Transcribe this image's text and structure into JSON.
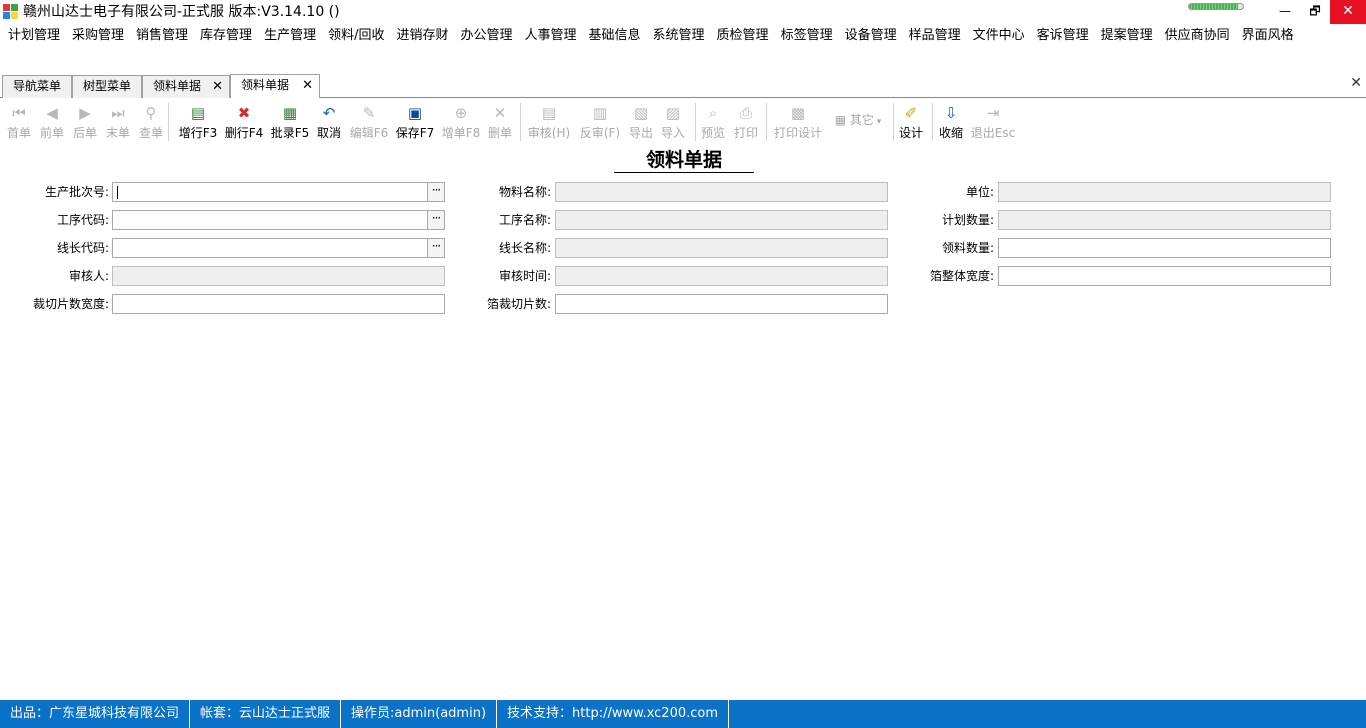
{
  "window": {
    "title": "赣州山达士电子有限公司-正式服 版本:V3.14.10 ()",
    "progress_value": 0.9,
    "minimize": "—",
    "maximize": "🗗",
    "close": "✕"
  },
  "menu": [
    "计划管理",
    "采购管理",
    "销售管理",
    "库存管理",
    "生产管理",
    "领料/回收",
    "进销存财",
    "办公管理",
    "人事管理",
    "基础信息",
    "系统管理",
    "质检管理",
    "标签管理",
    "设备管理",
    "样品管理",
    "文件中心",
    "客诉管理",
    "提案管理",
    "供应商协同",
    "界面风格"
  ],
  "tabs": [
    {
      "label": "导航菜单",
      "closable": false,
      "active": false
    },
    {
      "label": "树型菜单",
      "closable": false,
      "active": false
    },
    {
      "label": "领料单据",
      "closable": true,
      "active": false
    },
    {
      "label": "领料单据",
      "closable": true,
      "active": true
    }
  ],
  "tab_close_glyph": "✕",
  "toolbar": [
    {
      "label": "首单",
      "icon": "first-record-icon",
      "glyph": "⏮",
      "enabled": false
    },
    {
      "label": "前单",
      "icon": "previous-record-icon",
      "glyph": "◀",
      "enabled": false
    },
    {
      "label": "后单",
      "icon": "next-record-icon",
      "glyph": "▶",
      "enabled": false
    },
    {
      "label": "末单",
      "icon": "last-record-icon",
      "glyph": "⏭",
      "enabled": false
    },
    {
      "label": "查单",
      "icon": "binoculars-icon",
      "glyph": "⚲",
      "enabled": false
    },
    {
      "label": "增行F3",
      "icon": "add-row-icon",
      "glyph": "▤",
      "enabled": true,
      "color": "#2e7d32"
    },
    {
      "label": "删行F4",
      "icon": "delete-row-icon",
      "glyph": "✖",
      "enabled": true,
      "color": "#d32f2f"
    },
    {
      "label": "批录F5",
      "icon": "batch-entry-icon",
      "glyph": "▦",
      "enabled": true,
      "color": "#2e7d32"
    },
    {
      "label": "取消",
      "icon": "undo-icon",
      "glyph": "↶",
      "enabled": true,
      "color": "#1565c0"
    },
    {
      "label": "编辑F6",
      "icon": "edit-icon",
      "glyph": "✎",
      "enabled": false
    },
    {
      "label": "保存F7",
      "icon": "save-icon",
      "glyph": "▣",
      "enabled": true,
      "color": "#0d47a1"
    },
    {
      "label": "增单F8",
      "icon": "add-document-icon",
      "glyph": "⊕",
      "enabled": false
    },
    {
      "label": "删单",
      "icon": "delete-document-icon",
      "glyph": "✕",
      "enabled": false
    },
    {
      "label": "审核(H)",
      "icon": "approve-icon",
      "glyph": "▤",
      "enabled": false
    },
    {
      "label": "反审(F)",
      "icon": "unapprove-icon",
      "glyph": "▥",
      "enabled": false
    },
    {
      "label": "导出",
      "icon": "export-icon",
      "glyph": "▧",
      "enabled": false
    },
    {
      "label": "导入",
      "icon": "import-icon",
      "glyph": "▨",
      "enabled": false
    },
    {
      "label": "预览",
      "icon": "preview-icon",
      "glyph": "⌕",
      "enabled": false
    },
    {
      "label": "打印",
      "icon": "printer-icon",
      "glyph": "⎙",
      "enabled": false
    },
    {
      "label": "打印设计",
      "icon": "print-design-icon",
      "glyph": "▩",
      "enabled": false
    },
    {
      "label": "其它",
      "icon": "more-icon",
      "glyph": "▦",
      "enabled": false,
      "dropdown": true
    },
    {
      "label": "设计",
      "icon": "design-icon",
      "glyph": "✐",
      "enabled": true,
      "color": "#e0a000"
    },
    {
      "label": "收缩",
      "icon": "collapse-icon",
      "glyph": "⇩",
      "enabled": true,
      "color": "#1565c0"
    },
    {
      "label": "退出Esc",
      "icon": "exit-icon",
      "glyph": "⇥",
      "enabled": false
    }
  ],
  "form": {
    "title": "领料单据",
    "fields": [
      {
        "key": "batch_no",
        "label": "生产批次号:",
        "value": "",
        "readonly": false,
        "lookup": true,
        "focused": true
      },
      {
        "key": "material_name",
        "label": "物料名称:",
        "value": "",
        "readonly": true
      },
      {
        "key": "unit",
        "label": "单位:",
        "value": "",
        "readonly": true
      },
      {
        "key": "process_code",
        "label": "工序代码:",
        "value": "",
        "readonly": false,
        "lookup": true
      },
      {
        "key": "process_name",
        "label": "工序名称:",
        "value": "",
        "readonly": true
      },
      {
        "key": "planned_qty",
        "label": "计划数量:",
        "value": "",
        "readonly": true
      },
      {
        "key": "line_leader_code",
        "label": "线长代码:",
        "value": "",
        "readonly": false,
        "lookup": true
      },
      {
        "key": "line_leader_name",
        "label": "线长名称:",
        "value": "",
        "readonly": true
      },
      {
        "key": "requisition_qty",
        "label": "领料数量:",
        "value": "",
        "readonly": false
      },
      {
        "key": "reviewer",
        "label": "审核人:",
        "value": "",
        "readonly": true
      },
      {
        "key": "review_time",
        "label": "审核时间:",
        "value": "",
        "readonly": true
      },
      {
        "key": "foil_width",
        "label": "箔整体宽度:",
        "value": "",
        "readonly": false
      },
      {
        "key": "cut_piece_width",
        "label": "裁切片数宽度:",
        "value": "",
        "readonly": false
      },
      {
        "key": "foil_cut_count",
        "label": "箔裁切片数:",
        "value": "",
        "readonly": false
      }
    ],
    "lookup_glyph": "···"
  },
  "status": [
    "出品：广东星城科技有限公司",
    "帐套：云山达士正式服",
    "操作员:admin(admin)",
    "技术支持：http://www.xc200.com"
  ]
}
